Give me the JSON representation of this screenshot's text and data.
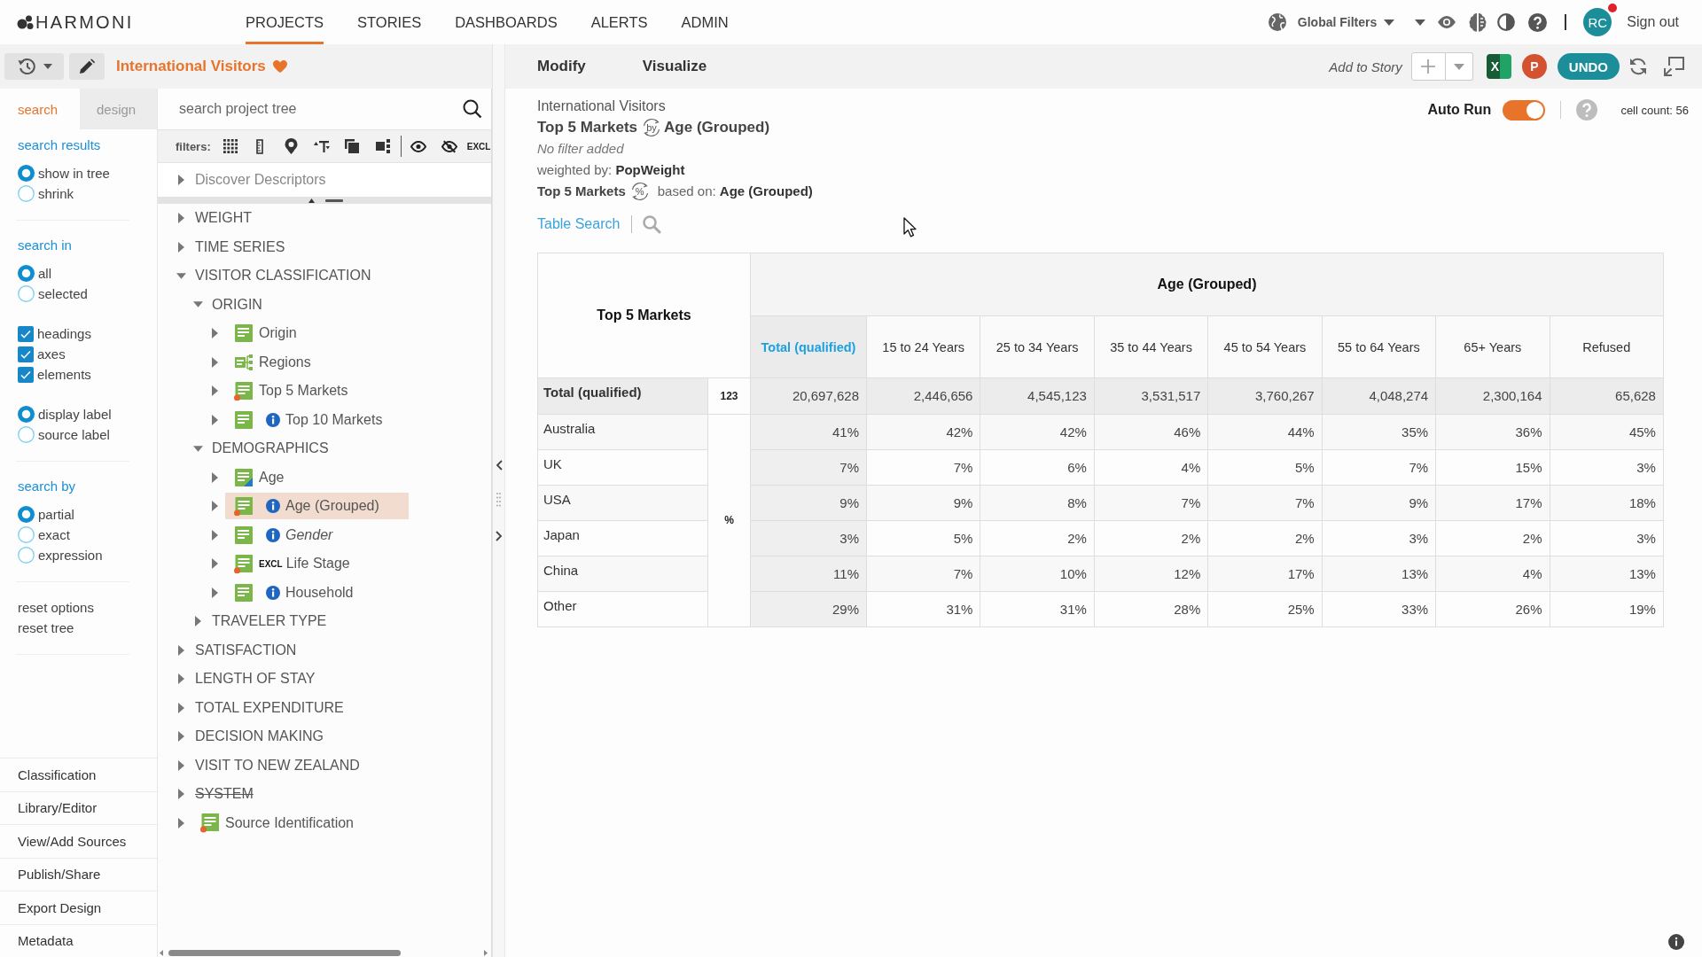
{
  "top_bar": {
    "logo": "HARMONI",
    "nav": [
      {
        "label": "PROJECTS",
        "selected": true
      },
      {
        "label": "STORIES",
        "selected": false
      },
      {
        "label": "DASHBOARDS",
        "selected": false
      },
      {
        "label": "ALERTS",
        "selected": false
      },
      {
        "label": "ADMIN",
        "selected": false
      }
    ],
    "global_filters": "Global Filters",
    "user": {
      "initials": "RC",
      "notification": true
    },
    "sign_out": "Sign out"
  },
  "project_bar": {
    "title": "International Visitors",
    "favorite": true
  },
  "toolbar": {
    "actions": [
      "Modify",
      "Visualize"
    ],
    "add_to_story": "Add to Story",
    "exports": [
      {
        "kind": "excel",
        "mark": "X"
      },
      {
        "kind": "powerpoint",
        "mark": "P"
      }
    ],
    "undo": "UNDO"
  },
  "sidebar": {
    "tabs": [
      {
        "label": "search",
        "selected": true
      },
      {
        "label": "design",
        "selected": false
      }
    ],
    "sections": [
      {
        "heading": "search results",
        "groups": [
          [
            {
              "kind": "radio",
              "label": "show in tree",
              "selected": true
            },
            {
              "kind": "radio",
              "label": "shrink",
              "selected": false
            }
          ]
        ]
      },
      {
        "heading": "search in",
        "groups": [
          [
            {
              "kind": "radio",
              "label": "all",
              "selected": true
            },
            {
              "kind": "radio",
              "label": "selected",
              "selected": false
            }
          ],
          [
            {
              "kind": "checkbox",
              "label": "headings",
              "checked": true
            },
            {
              "kind": "checkbox",
              "label": "axes",
              "checked": true
            },
            {
              "kind": "checkbox",
              "label": "elements",
              "checked": true
            }
          ],
          [
            {
              "kind": "radio",
              "label": "display label",
              "selected": true
            },
            {
              "kind": "radio",
              "label": "source label",
              "selected": false
            }
          ]
        ]
      },
      {
        "heading": "search by",
        "groups": [
          [
            {
              "kind": "radio",
              "label": "partial",
              "selected": true
            },
            {
              "kind": "radio",
              "label": "exact",
              "selected": false
            },
            {
              "kind": "radio",
              "label": "expression",
              "selected": false
            }
          ]
        ]
      }
    ],
    "links": [
      "reset options",
      "reset tree"
    ],
    "menu": [
      "Classification",
      "Library/Editor",
      "View/Add Sources",
      "Publish/Share",
      "Export Design",
      "Metadata"
    ]
  },
  "tree_panel": {
    "search": {
      "placeholder": "search project tree"
    },
    "filters": {
      "label": "filters:",
      "exclude_toggle": "EXCL"
    },
    "discover": {
      "label": "Discover Descriptors",
      "expanded": false
    },
    "nodes": [
      {
        "kind": "folder",
        "label": "WEIGHT",
        "expanded": false,
        "selected": false
      },
      {
        "kind": "folder",
        "label": "TIME SERIES",
        "expanded": false,
        "selected": false
      },
      {
        "kind": "folder",
        "label": "VISITOR CLASSIFICATION",
        "expanded": true,
        "selected": false,
        "children": [
          {
            "kind": "folder",
            "label": "ORIGIN",
            "expanded": true,
            "selected": false,
            "children": [
              {
                "kind": "list",
                "label": "Origin",
                "expanded": false,
                "selected": false,
                "marked": false,
                "info": false
              },
              {
                "kind": "hierarchy",
                "label": "Regions",
                "expanded": false,
                "selected": false,
                "marked": false,
                "info": false
              },
              {
                "kind": "list",
                "label": "Top 5 Markets",
                "expanded": false,
                "selected": false,
                "marked": true,
                "info": false
              },
              {
                "kind": "list",
                "label": "Top 10 Markets",
                "expanded": false,
                "selected": false,
                "marked": false,
                "info": true
              }
            ]
          },
          {
            "kind": "folder",
            "label": "DEMOGRAPHICS",
            "expanded": true,
            "selected": false,
            "children": [
              {
                "kind": "numeric",
                "label": "Age",
                "expanded": false,
                "selected": false,
                "marked": false,
                "info": false
              },
              {
                "kind": "list",
                "label": "Age (Grouped)",
                "expanded": false,
                "selected": true,
                "marked": true,
                "info": true
              },
              {
                "kind": "list",
                "label": "Gender",
                "expanded": false,
                "selected": false,
                "marked": false,
                "info": true,
                "italic": true
              },
              {
                "kind": "list",
                "label": "Life Stage",
                "expanded": false,
                "selected": false,
                "marked": true,
                "info": false,
                "tag": "EXCL"
              },
              {
                "kind": "list",
                "label": "Household",
                "expanded": false,
                "selected": false,
                "marked": false,
                "info": true
              }
            ]
          },
          {
            "kind": "folder",
            "label": "TRAVELER TYPE",
            "expanded": false,
            "selected": false
          }
        ]
      },
      {
        "kind": "folder",
        "label": "SATISFACTION",
        "expanded": false,
        "selected": false
      },
      {
        "kind": "folder",
        "label": "LENGTH OF STAY",
        "expanded": false,
        "selected": false
      },
      {
        "kind": "folder",
        "label": "TOTAL EXPENDITURE",
        "expanded": false,
        "selected": false
      },
      {
        "kind": "folder",
        "label": "DECISION MAKING",
        "expanded": false,
        "selected": false
      },
      {
        "kind": "folder",
        "label": "VISIT TO NEW ZEALAND",
        "expanded": false,
        "selected": false
      },
      {
        "kind": "folder",
        "label": "SYSTEM",
        "expanded": false,
        "selected": false,
        "struck": true
      },
      {
        "kind": "list",
        "label": "Source Identification",
        "expanded": false,
        "selected": false,
        "marked": true,
        "info": false
      }
    ]
  },
  "report": {
    "project": "International Visitors",
    "row_variable": "Top 5 Markets",
    "connector": "by",
    "column_variable": "Age (Grouped)",
    "filter_note": "No filter added",
    "weighting": "weighted by: **PopWeight**",
    "base_variable": "Top 5 Markets",
    "base_symbol": "%",
    "base": "based on: **Age (Grouped)**",
    "table_search": "Table Search",
    "auto_run": {
      "label": "Auto Run",
      "on": true
    },
    "cell_count": "cell count: 56"
  },
  "table": {
    "stub_heading": "Top 5 Markets",
    "column_group": "Age (Grouped)",
    "category_measure": "%",
    "columns": [
      {
        "label": "Total (qualified)",
        "kind": "total"
      },
      {
        "label": "15 to 24 Years",
        "kind": "category"
      },
      {
        "label": "25 to 34 Years",
        "kind": "category"
      },
      {
        "label": "35 to 44 Years",
        "kind": "category"
      },
      {
        "label": "45 to 54 Years",
        "kind": "category"
      },
      {
        "label": "55 to 64 Years",
        "kind": "category"
      },
      {
        "label": "65+ Years",
        "kind": "category"
      },
      {
        "label": "Refused",
        "kind": "category"
      }
    ],
    "rows": [
      {
        "label": "Total (qualified)",
        "kind": "total",
        "measure": "123",
        "cells": [
          "20,697,628",
          "2,446,656",
          "4,545,123",
          "3,531,517",
          "3,760,267",
          "4,048,274",
          "2,300,164",
          "65,628"
        ]
      },
      {
        "label": "Australia",
        "kind": "category",
        "cells": [
          "41%",
          "42%",
          "42%",
          "46%",
          "44%",
          "35%",
          "36%",
          "45%"
        ]
      },
      {
        "label": "UK",
        "kind": "category",
        "cells": [
          "7%",
          "7%",
          "6%",
          "4%",
          "5%",
          "7%",
          "15%",
          "3%"
        ]
      },
      {
        "label": "USA",
        "kind": "category",
        "cells": [
          "9%",
          "9%",
          "8%",
          "7%",
          "7%",
          "9%",
          "17%",
          "18%"
        ]
      },
      {
        "label": "Japan",
        "kind": "category",
        "cells": [
          "3%",
          "5%",
          "2%",
          "2%",
          "2%",
          "3%",
          "2%",
          "3%"
        ]
      },
      {
        "label": "China",
        "kind": "category",
        "cells": [
          "11%",
          "7%",
          "10%",
          "12%",
          "17%",
          "13%",
          "4%",
          "13%"
        ]
      },
      {
        "label": "Other",
        "kind": "category",
        "cells": [
          "29%",
          "31%",
          "31%",
          "28%",
          "25%",
          "33%",
          "26%",
          "19%"
        ]
      }
    ]
  }
}
